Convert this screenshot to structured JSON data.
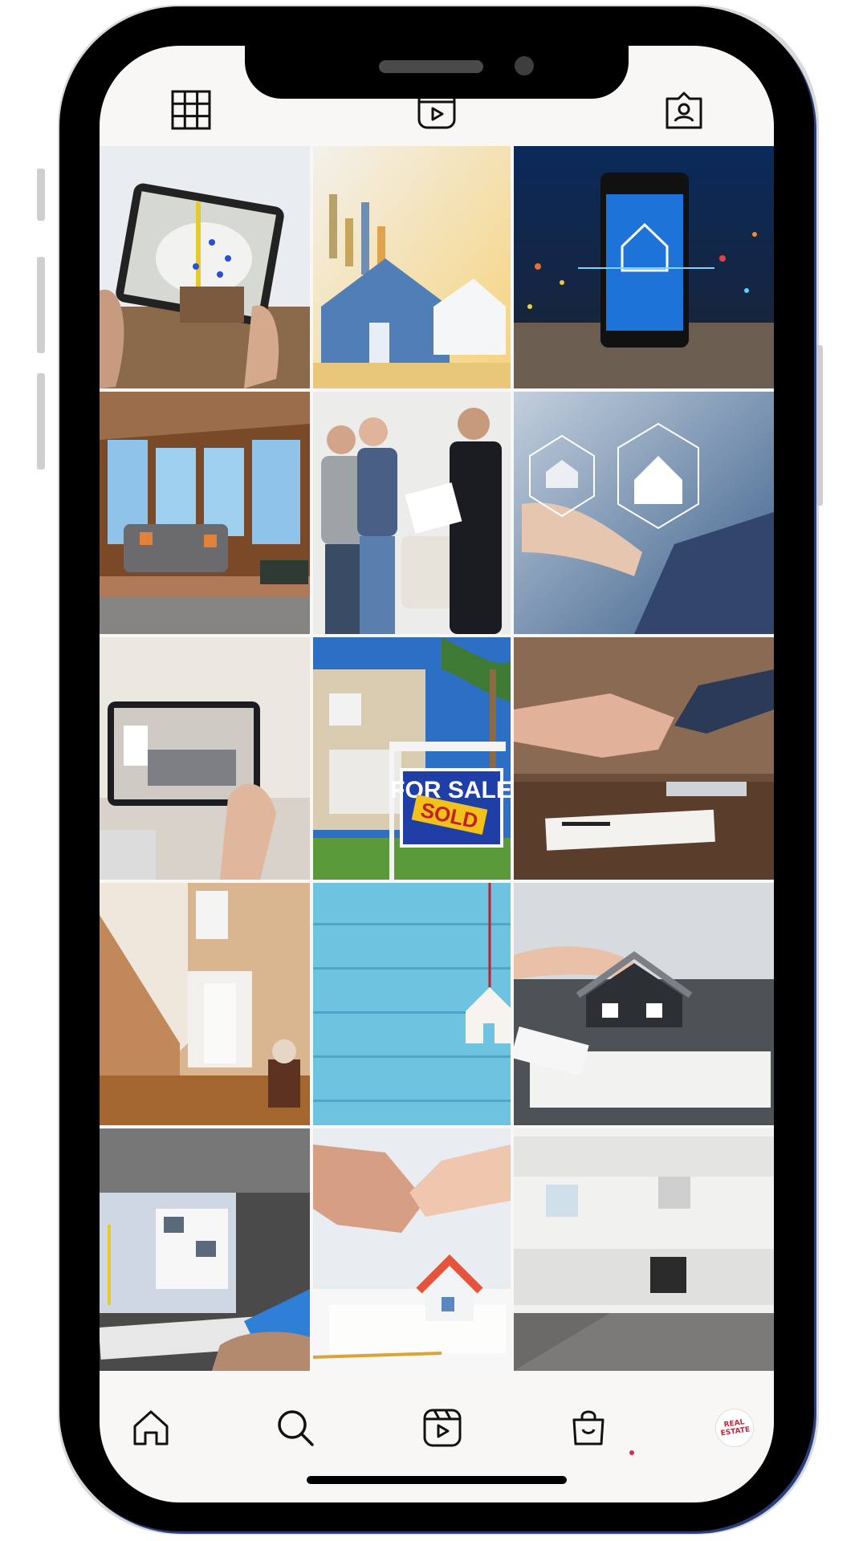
{
  "profile_tabs": [
    {
      "name": "grid-icon",
      "active": true
    },
    {
      "name": "reels-icon",
      "active": false
    },
    {
      "name": "tagged-icon",
      "active": false
    }
  ],
  "posts": [
    {
      "subject": "tablet-map-listing"
    },
    {
      "subject": "house-model-chart"
    },
    {
      "subject": "smartphone-house-app"
    },
    {
      "subject": "sunroom-living-room"
    },
    {
      "subject": "agent-handshake-couple"
    },
    {
      "subject": "laptop-house-hexagons"
    },
    {
      "subject": "tablet-virtual-tour"
    },
    {
      "subject": "for-sale-sign",
      "sign_text": "FOR SALE",
      "sticker_text": "SOLD"
    },
    {
      "subject": "business-handshake"
    },
    {
      "subject": "staircase-foyer"
    },
    {
      "subject": "blue-wood-house-tag"
    },
    {
      "subject": "hands-house-model"
    },
    {
      "subject": "laptop-map-listing"
    },
    {
      "subject": "handshake-house-contract"
    },
    {
      "subject": "white-kitchen"
    }
  ],
  "bottom_nav": [
    {
      "name": "home-icon"
    },
    {
      "name": "search-icon"
    },
    {
      "name": "reels-nav-icon"
    },
    {
      "name": "shop-icon"
    },
    {
      "name": "profile-avatar"
    }
  ],
  "avatar": {
    "line1": "REAL",
    "line2": "ESTATE"
  },
  "colors": {
    "frame": "#000000",
    "screen_bg": "#f8f7f5",
    "notification_dot": "#e0245e",
    "sign_blue": "#1f3fa6",
    "sticker_yellow": "#f2c21a"
  }
}
